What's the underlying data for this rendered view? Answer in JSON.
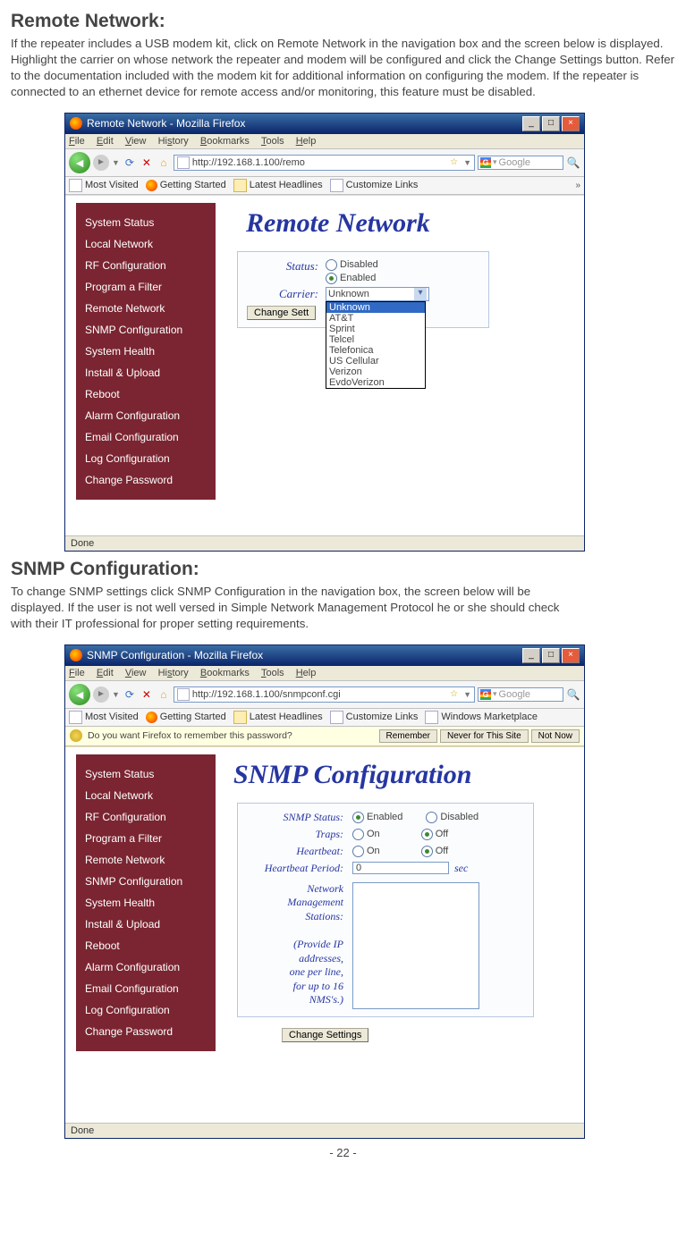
{
  "section1": {
    "heading": "Remote Network:",
    "body": "If the repeater includes a USB modem kit, click on Remote Network in the navigation box and the screen below is displayed. Highlight the carrier on whose network the repeater and modem will be configured and click the Change Settings button. Refer to the documentation included with the modem kit for additional information on configuring the modem. If the repeater is connected to an ethernet device for remote access and/or monitoring, this feature must be disabled."
  },
  "section2": {
    "heading": "SNMP Configuration:",
    "body": "To change SNMP settings click SNMP Configuration in the navigation box, the screen below will be displayed. If the user is not well versed in Simple Network Management Protocol he or she should check with their IT professional for proper setting requirements."
  },
  "shot1": {
    "title": "Remote Network - Mozilla Firefox",
    "url": "http://192.168.1.100/remo",
    "search_placeholder": "Google",
    "menus": {
      "file": "File",
      "edit": "Edit",
      "view": "View",
      "history": "History",
      "bookmarks": "Bookmarks",
      "tools": "Tools",
      "help": "Help"
    },
    "bookmarks": {
      "most": "Most Visited",
      "getting": "Getting Started",
      "latest": "Latest Headlines",
      "custom": "Customize Links"
    },
    "sidebar": [
      "System Status",
      "Local Network",
      "RF Configuration",
      "Program a Filter",
      "Remote Network",
      "SNMP Configuration",
      "System Health",
      "Install & Upload",
      "Reboot",
      "Alarm Configuration",
      "Email Configuration",
      "Log Configuration",
      "Change Password"
    ],
    "page_title": "Remote Network",
    "status_label": "Status:",
    "status_opts": {
      "disabled": "Disabled",
      "enabled": "Enabled"
    },
    "carrier_label": "Carrier:",
    "carrier_value": "Unknown",
    "carrier_opts": [
      "Unknown",
      "AT&T",
      "Sprint",
      "Telcel",
      "Telefonica",
      "US Cellular",
      "Verizon",
      "EvdoVerizon"
    ],
    "change_btn": "Change Sett",
    "statusbar": "Done"
  },
  "shot2": {
    "title": "SNMP Configuration - Mozilla Firefox",
    "url": "http://192.168.1.100/snmpconf.cgi",
    "search_placeholder": "Google",
    "menus": {
      "file": "File",
      "edit": "Edit",
      "view": "View",
      "history": "History",
      "bookmarks": "Bookmarks",
      "tools": "Tools",
      "help": "Help"
    },
    "bookmarks": {
      "most": "Most Visited",
      "getting": "Getting Started",
      "latest": "Latest Headlines",
      "custom": "Customize Links",
      "winmp": "Windows Marketplace"
    },
    "passbar": {
      "text": "Do you want Firefox to remember this password?",
      "remember": "Remember",
      "never": "Never for This Site",
      "notnow": "Not Now"
    },
    "sidebar": [
      "System Status",
      "Local Network",
      "RF Configuration",
      "Program a Filter",
      "Remote Network",
      "SNMP Configuration",
      "System Health",
      "Install & Upload",
      "Reboot",
      "Alarm Configuration",
      "Email Configuration",
      "Log Configuration",
      "Change Password"
    ],
    "page_title": "SNMP Configuration",
    "snmp_status_label": "SNMP Status:",
    "enabled": "Enabled",
    "disabled": "Disabled",
    "traps_label": "Traps:",
    "on": "On",
    "off": "Off",
    "heartbeat_label": "Heartbeat:",
    "hb_period_label": "Heartbeat Period:",
    "hb_value": "0",
    "sec": "sec",
    "nms_label": "Network\nManagement\nStations:\n\n(Provide IP\naddresses,\none per line,\nfor up to 16\nNMS's.)",
    "nms_l1": "Network",
    "nms_l2": "Management",
    "nms_l3": "Stations:",
    "nms_l4": "(Provide IP",
    "nms_l5": "addresses,",
    "nms_l6": "one per line,",
    "nms_l7": "for up to 16",
    "nms_l8": "NMS's.)",
    "change_btn": "Change Settings",
    "statusbar": "Done"
  },
  "page_number": "- 22 -"
}
